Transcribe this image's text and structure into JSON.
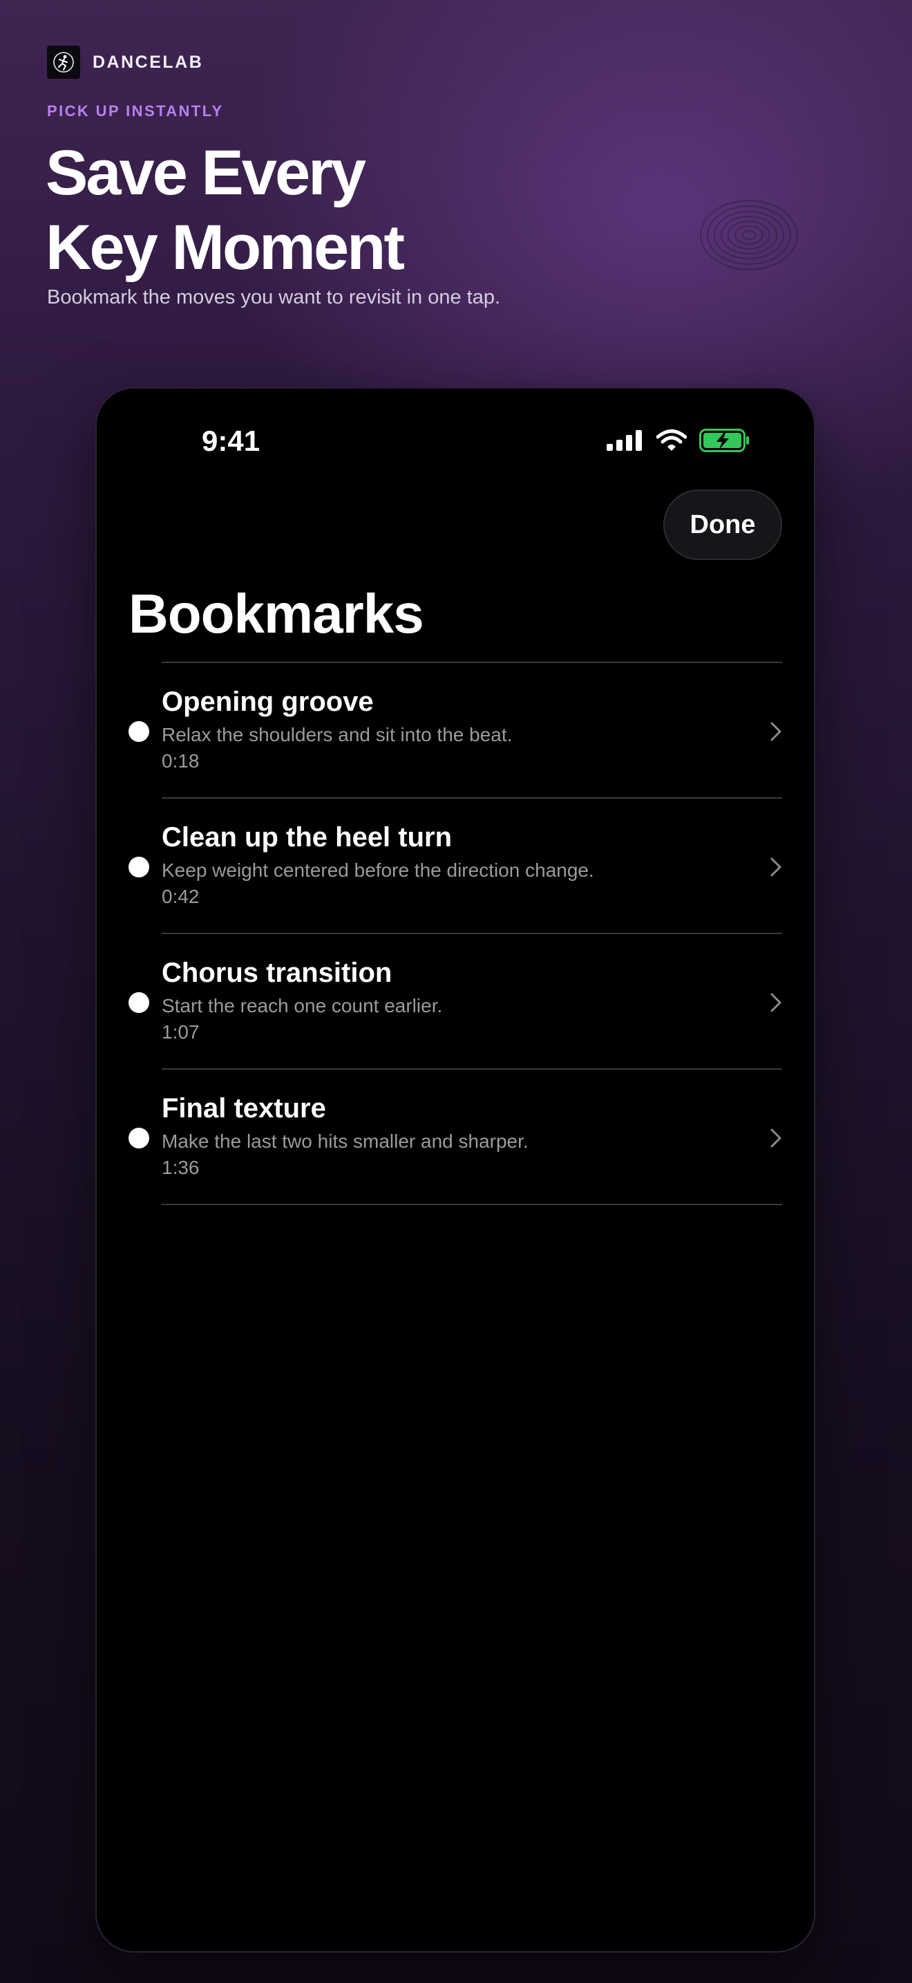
{
  "brand": {
    "name": "DANCELAB",
    "logo_icon": "dancer-icon"
  },
  "hero": {
    "eyebrow": "PICK UP INSTANTLY",
    "headline_line1": "Save Every",
    "headline_line2": "Key Moment",
    "subhead": "Bookmark the moves you want to revisit in one tap."
  },
  "status_bar": {
    "time": "9:41",
    "icons": [
      "cellular-signal-icon",
      "wifi-icon",
      "battery-charging-icon"
    ],
    "battery_color": "#34c759"
  },
  "screen": {
    "done_label": "Done",
    "title": "Bookmarks"
  },
  "bookmarks": [
    {
      "title": "Opening groove",
      "description": "Relax the shoulders and sit into the beat.",
      "time": "0:18"
    },
    {
      "title": "Clean up the heel turn",
      "description": "Keep weight centered before the direction change.",
      "time": "0:42"
    },
    {
      "title": "Chorus transition",
      "description": "Start the reach one count earlier.",
      "time": "1:07"
    },
    {
      "title": "Final texture",
      "description": "Make the last two hits smaller and sharper.",
      "time": "1:36"
    }
  ],
  "colors": {
    "accent": "#b780f0",
    "background_top": "#3e2552",
    "background_bottom": "#120a18",
    "secondary_text": "#9a9aa0"
  }
}
